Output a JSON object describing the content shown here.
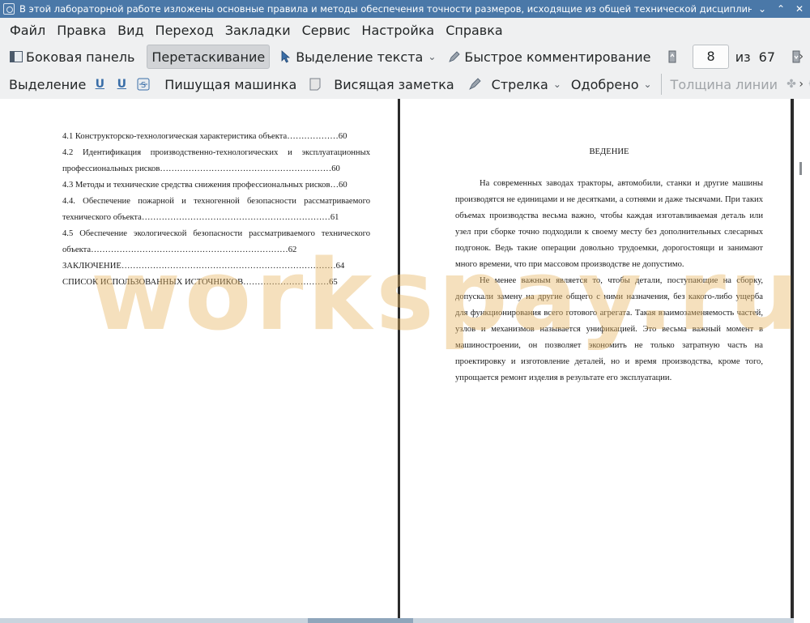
{
  "window": {
    "title": "В этой лабораторной работе изложены основные правила и методы обеспечения точности размеров, исходящие из общей технической дисциплины: «До…",
    "controls": [
      "⌄",
      "⌃",
      "✕"
    ]
  },
  "menubar": {
    "items": [
      "Файл",
      "Правка",
      "Вид",
      "Переход",
      "Закладки",
      "Сервис",
      "Настройка",
      "Справка"
    ]
  },
  "toolbar1": {
    "sidebar_label": "Боковая панель",
    "drag_label": "Перетаскивание",
    "text_select_label": "Выделение текста",
    "quick_comment_label": "Быстрое комментирование",
    "current_page": "8",
    "of_label": "из",
    "total_pages": "67"
  },
  "toolbar2": {
    "selection_label": "Выделение",
    "typewriter_label": "Пишущая машинка",
    "sticky_note_label": "Висящая заметка",
    "arrow_label": "Стрелка",
    "approved_label": "Одобрено",
    "line_width_label": "Толщина линии"
  },
  "document": {
    "left_page": {
      "toc": [
        "4.1 Конструкторско-технологическая характеристика объекта………………60",
        "4.2 Идентификация производственно-технологических и эксплуатационных профессиональных рисков……………………………………………………60",
        "4.3 Методы и технические средства снижения профессиональных рисков…60",
        "4.4. Обеспечение пожарной и техногенной безопасности рассматриваемого технического объекта…………………………………………………………61",
        "4.5 Обеспечение экологической безопасности рассматриваемого технического объекта……………………………………………………………62",
        "ЗАКЛЮЧЕНИЕ…………………………………………………………………64",
        "СПИСОК ИСПОЛЬЗОВАННЫХ ИСТОЧНИКОВ…………………………65"
      ]
    },
    "right_page": {
      "heading": "ВЕДЕНИЕ",
      "paragraphs": [
        "На современных заводах тракторы, автомобили, станки и другие машины производятся не единицами и не десятками, а сотнями и даже тысячами. При таких объемах производства весьма важно, чтобы каждая изготавливаемая деталь или узел при сборке точно подходили к своему месту без дополнительных слесарных подгонок. Ведь такие операции довольно трудоемки, дорогостоящи и занимают много времени, что при массовом производстве не допустимо.",
        "Не менее важным является то, чтобы детали, поступающие на сборку, допускали замену на другие общего с ними назначения, без какого-либо ущерба для функционирования всего готового агрегата. Такая взаимозаменяемость частей, узлов и механизмов называется унификацией. Это весьма важный момент в машиностроении, он позволяет экономить не только затратную часть на проектировку и изготовление деталей, но и время производства, кроме того, упрощается ремонт изделия в результате его эксплуатации."
      ]
    },
    "watermark": "workspay.ru"
  },
  "icons": {
    "sidebar": "sidebar-icon",
    "pointer": "cursor-arrow-icon",
    "pen": "pen-icon",
    "page_up": "page-up-icon",
    "page_down": "page-down-icon"
  }
}
